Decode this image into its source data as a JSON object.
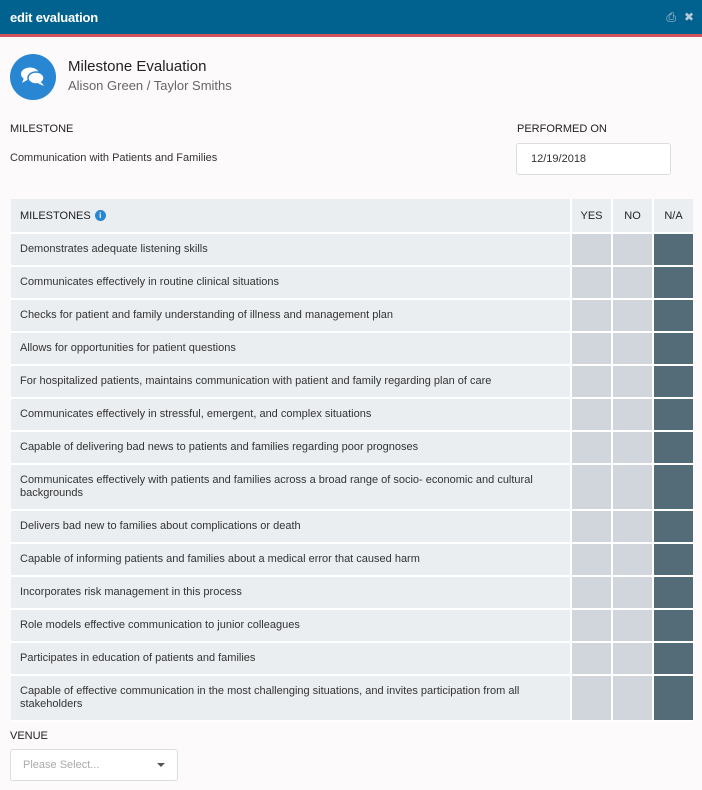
{
  "window": {
    "title": "edit evaluation",
    "print_icon": "⎙",
    "close_icon": "✖"
  },
  "header": {
    "title": "Milestone Evaluation",
    "subtitle": "Alison Green / Taylor Smiths",
    "avatar_icon": "chat-bubbles-icon"
  },
  "milestone": {
    "label": "MILESTONE",
    "value": "Communication with Patients and Families"
  },
  "performed_on": {
    "label": "PERFORMED ON",
    "value": "12/19/2018"
  },
  "table": {
    "header": "MILESTONES",
    "info_icon": "i",
    "columns": [
      "YES",
      "NO",
      "N/A"
    ],
    "accent_selected": "#546c77",
    "rows": [
      {
        "text": "Demonstrates adequate listening skills",
        "selected": "N/A"
      },
      {
        "text": "Communicates effectively in routine clinical situations",
        "selected": "N/A"
      },
      {
        "text": "Checks for patient and family understanding of illness and management plan",
        "selected": "N/A"
      },
      {
        "text": "Allows for opportunities for patient questions",
        "selected": "N/A"
      },
      {
        "text": "For hospitalized patients, maintains communication with patient and family regarding plan of care",
        "selected": "N/A"
      },
      {
        "text": "Communicates effectively in stressful, emergent, and complex situations",
        "selected": "N/A"
      },
      {
        "text": "Capable of delivering bad news to patients and families regarding poor prognoses",
        "selected": "N/A"
      },
      {
        "text": "Communicates effectively with patients and families across a broad range of socio- economic and cultural backgrounds",
        "selected": "N/A"
      },
      {
        "text": "Delivers bad new to families about complications or death",
        "selected": "N/A"
      },
      {
        "text": "Capable of informing patients and families about a medical error that caused harm",
        "selected": "N/A"
      },
      {
        "text": "Incorporates risk management in this process",
        "selected": "N/A"
      },
      {
        "text": "Role models effective communication to junior colleagues",
        "selected": "N/A"
      },
      {
        "text": "Participates in education of patients and families",
        "selected": "N/A"
      },
      {
        "text": "Capable of effective communication in the most challenging situations, and invites participation from all stakeholders",
        "selected": "N/A"
      }
    ]
  },
  "venue": {
    "label": "VENUE",
    "placeholder": "Please Select..."
  }
}
